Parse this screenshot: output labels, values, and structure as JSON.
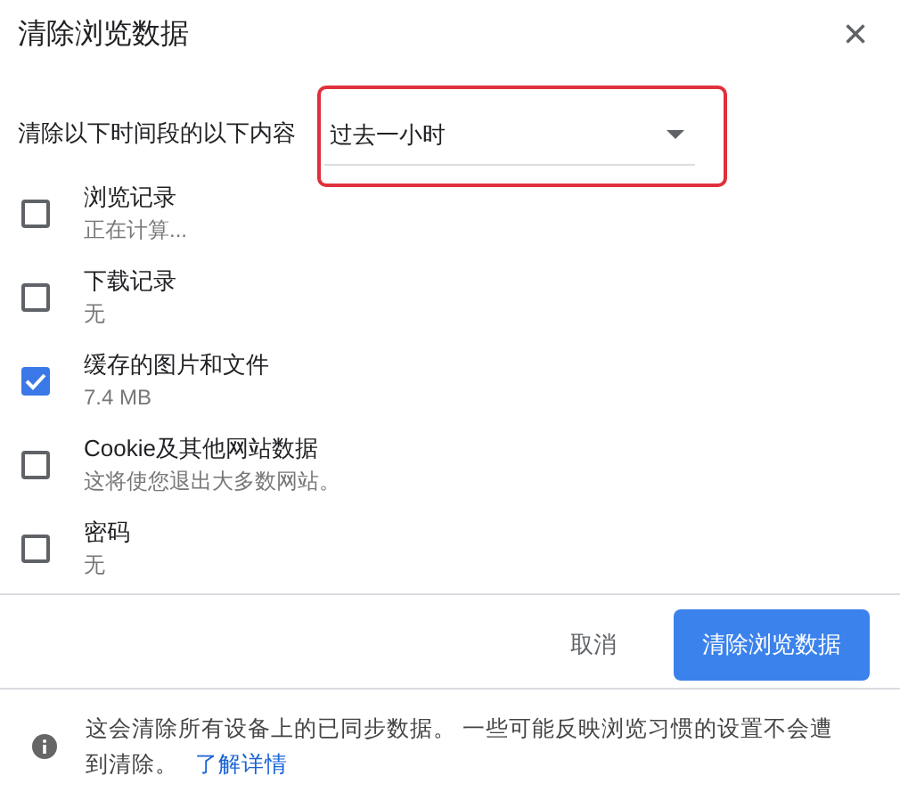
{
  "dialog": {
    "title": "清除浏览数据",
    "close": "×"
  },
  "time_range": {
    "label": "清除以下时间段的以下内容",
    "value": "过去一小时",
    "highlighted": true
  },
  "items": [
    {
      "label": "浏览记录",
      "detail": "正在计算...",
      "checked": false
    },
    {
      "label": "下载记录",
      "detail": "无",
      "checked": false
    },
    {
      "label": "缓存的图片和文件",
      "detail": "7.4 MB",
      "checked": true
    },
    {
      "label": "Cookie及其他网站数据",
      "detail": "这将使您退出大多数网站。",
      "checked": false
    },
    {
      "label": "密码",
      "detail": "无",
      "checked": false
    }
  ],
  "buttons": {
    "cancel": "取消",
    "confirm": "清除浏览数据"
  },
  "footer": {
    "text": "这会清除所有设备上的已同步数据。 一些可能反映浏览习惯的设置不会遭到清除。",
    "link": "了解详情"
  }
}
